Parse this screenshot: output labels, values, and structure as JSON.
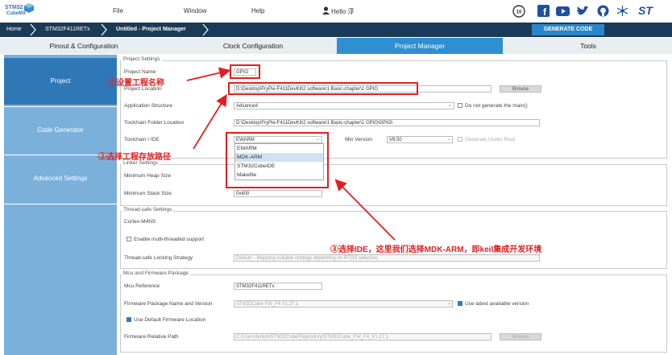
{
  "logo": {
    "line1": "STM32",
    "line2": "CubeMX"
  },
  "menu": {
    "file": "File",
    "window": "Window",
    "help": "Help",
    "user": "Hello 浮"
  },
  "social_icons": [
    "ten-year-badge-icon",
    "facebook-icon",
    "youtube-icon",
    "twitter-icon",
    "github-icon",
    "network-icon",
    "st-logo-icon"
  ],
  "st_logo": "ST",
  "breadcrumb": {
    "home": "Home",
    "mcu": "STM32F411RETx",
    "project": "Untitled - Project Manager"
  },
  "generate_code": "GENERATE CODE",
  "tabs": {
    "pinout": "Pinout & Configuration",
    "clock": "Clock Configuration",
    "project_manager": "Project Manager",
    "tools": "Tools"
  },
  "sidenav": {
    "project": "Project",
    "code_generator": "Code Generator",
    "advanced": "Advanced Settings"
  },
  "project_settings": {
    "legend": "Project Settings",
    "name_label": "Project Name",
    "name_value": "GPIO",
    "location_label": "Project Location",
    "location_value": "D:\\Desktop\\FryPie-F411DevKit\\2 software\\1 Basic-chapter\\1 GPIO",
    "browse": "Browse",
    "app_structure_label": "Application Structure",
    "app_structure_value": "Advanced",
    "do_not_generate": "Do not generate the main()",
    "toolchain_folder_label": "Toolchain Folder Location",
    "toolchain_folder_value": "D:\\Desktop\\FryPie-F411DevKit\\2 software\\1 Basic-chapter\\1 GPIO\\GPIO\\",
    "toolchain_label": "Toolchain / IDE",
    "toolchain_value": "EWARM",
    "min_version_label": "Min Version",
    "min_version_value": "V8.50",
    "generate_under_root": "Generate Under Root",
    "toolchain_options": [
      "EWARM",
      "MDK-ARM",
      "STM32CubeIDE",
      "Makefile"
    ]
  },
  "linker_settings": {
    "legend": "Linker Settings",
    "heap_label": "Minimum Heap Size",
    "stack_label": "Minimum Stack Size",
    "stack_value": "0x400"
  },
  "thread_safe": {
    "legend": "Thread-safe Settings",
    "core": "Cortex-M4NS",
    "enable_multithread": "Enable multi-threaded support",
    "locking_label": "Thread-safe Locking Strategy",
    "locking_value": "Default  –  Mapping suitable strategy depending on RTOS selection."
  },
  "mcu_firmware": {
    "legend": "Mcu and Firmware Package",
    "mcu_ref_label": "Mcu Reference",
    "mcu_ref_value": "STM32F411RETx",
    "fw_name_label": "Firmware Package Name and Version",
    "fw_name_value": "STM32Cube FW_F4 V1.27.1",
    "use_latest": "Use latest available version",
    "use_default_loc": "Use Default Firmware Location",
    "fw_path_label": "Firmware Relative Path",
    "fw_path_value": "C:/Users/lenlon/STM32Cube/Repository/STM32Cube_FW_F4_V1.27.1",
    "browse": "Browse"
  },
  "annotations": {
    "a1": "①设置工程名称",
    "a2": "②选择工程存放路径",
    "a3": "③选择IDE，这里我们选择MDK-ARM，即keil集成开发环境"
  },
  "colors": {
    "accent": "#2f8fd0",
    "dark_bar": "#1b3a57",
    "annotation": "#e02020",
    "sidenav": "#7bb0db"
  }
}
